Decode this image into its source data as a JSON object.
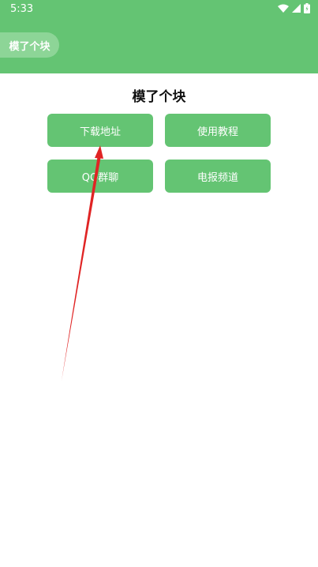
{
  "status_bar": {
    "time": "5:33",
    "icons": [
      "wifi-icon",
      "signal-icon",
      "battery-icon"
    ]
  },
  "app": {
    "chip_label": "模了个块",
    "title": "模了个块"
  },
  "buttons": [
    {
      "label": "下载地址"
    },
    {
      "label": "使用教程"
    },
    {
      "label": "QQ群聊"
    },
    {
      "label": "电报频道"
    }
  ],
  "colors": {
    "primary": "#64c473",
    "chip": "#8dd597",
    "annotation_arrow": "#e02424"
  }
}
